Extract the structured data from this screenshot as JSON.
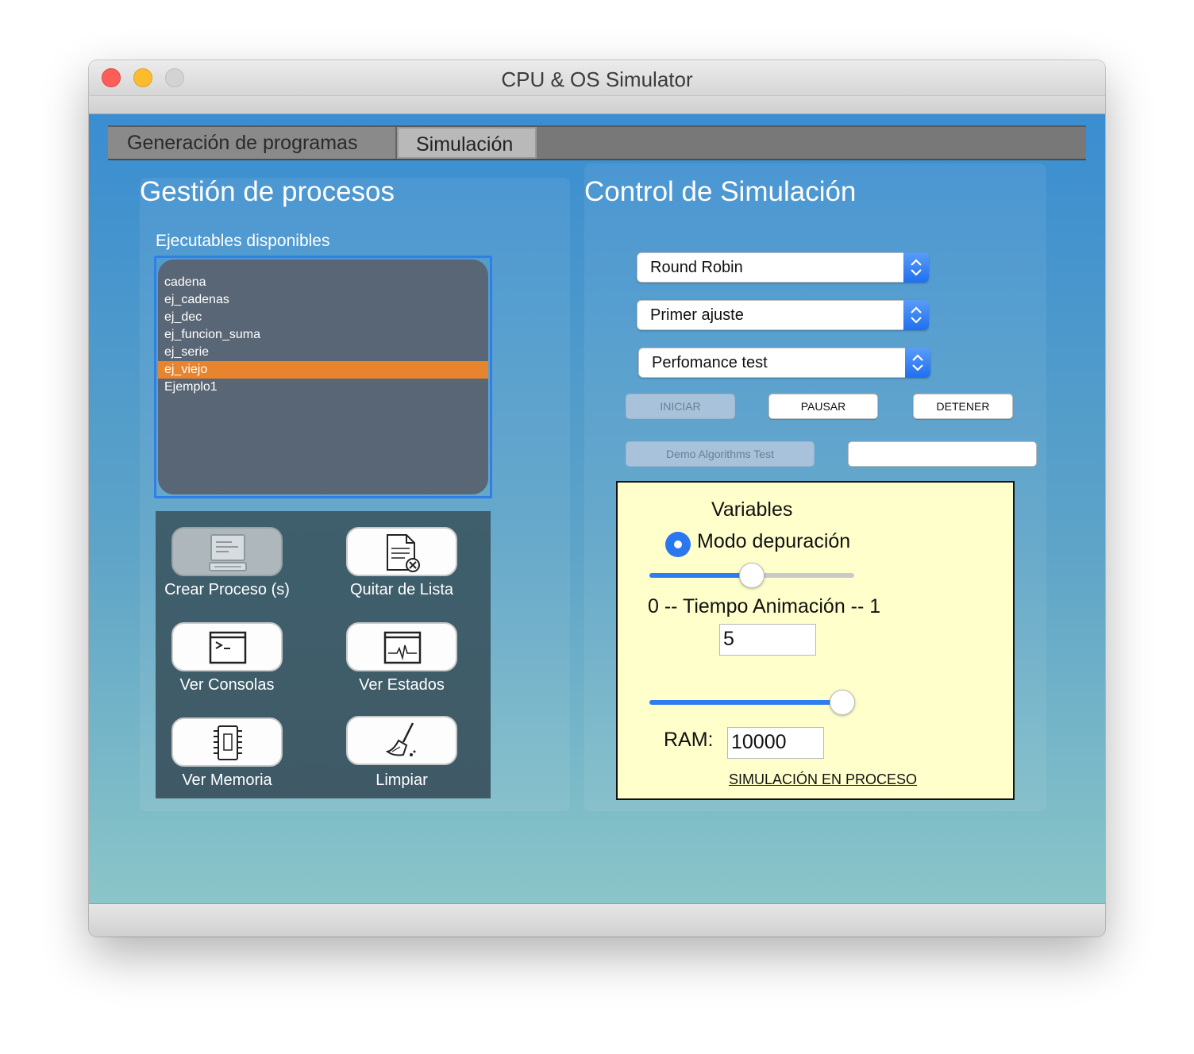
{
  "window": {
    "title": "CPU & OS Simulator"
  },
  "tabs": [
    {
      "label": "Generación de programas"
    },
    {
      "label": "Simulación"
    }
  ],
  "process_panel": {
    "heading": "Gestión de procesos",
    "list_label": "Ejecutables disponibles",
    "executables": [
      "cadena",
      "ej_cadenas",
      "ej_dec",
      "ej_funcion_suma",
      "ej_serie",
      "ej_viejo",
      "Ejemplo1"
    ],
    "selected": "ej_viejo",
    "tools": {
      "create": {
        "label": "Crear Proceso (s)",
        "icon": "create-process-icon",
        "enabled": false
      },
      "remove": {
        "label": "Quitar de Lista",
        "icon": "remove-document-icon"
      },
      "consoles": {
        "label": "Ver Consolas",
        "icon": "terminal-icon"
      },
      "states": {
        "label": "Ver Estados",
        "icon": "activity-monitor-icon"
      },
      "memory": {
        "label": "Ver Memoria",
        "icon": "memory-chip-icon"
      },
      "clear": {
        "label": "Limpiar",
        "icon": "broom-icon"
      }
    }
  },
  "control_panel": {
    "heading": "Control de Simulación",
    "scheduler": "Round Robin",
    "memory_policy": "Primer ajuste",
    "test_mode": "Perfomance test",
    "buttons": {
      "start": "INICIAR",
      "pause": "PAUSAR",
      "stop": "DETENER",
      "demo": "Demo Algorithms Test"
    },
    "demo_field_value": "",
    "variables": {
      "title": "Variables",
      "debug_mode_label": "Modo depuración",
      "debug_mode_selected": true,
      "animation_slider_fraction": 0.5,
      "animation_label": "0 -- Tiempo Animación -- 1",
      "animation_value": "5",
      "ram_slider_fraction": 0.94,
      "ram_label": "RAM:",
      "ram_value": "10000",
      "status": "SIMULACIÓN EN PROCESO"
    }
  },
  "colors": {
    "accent": "#2f7ef0",
    "selection": "#e8842e",
    "variables_bg": "#ffffcc"
  }
}
